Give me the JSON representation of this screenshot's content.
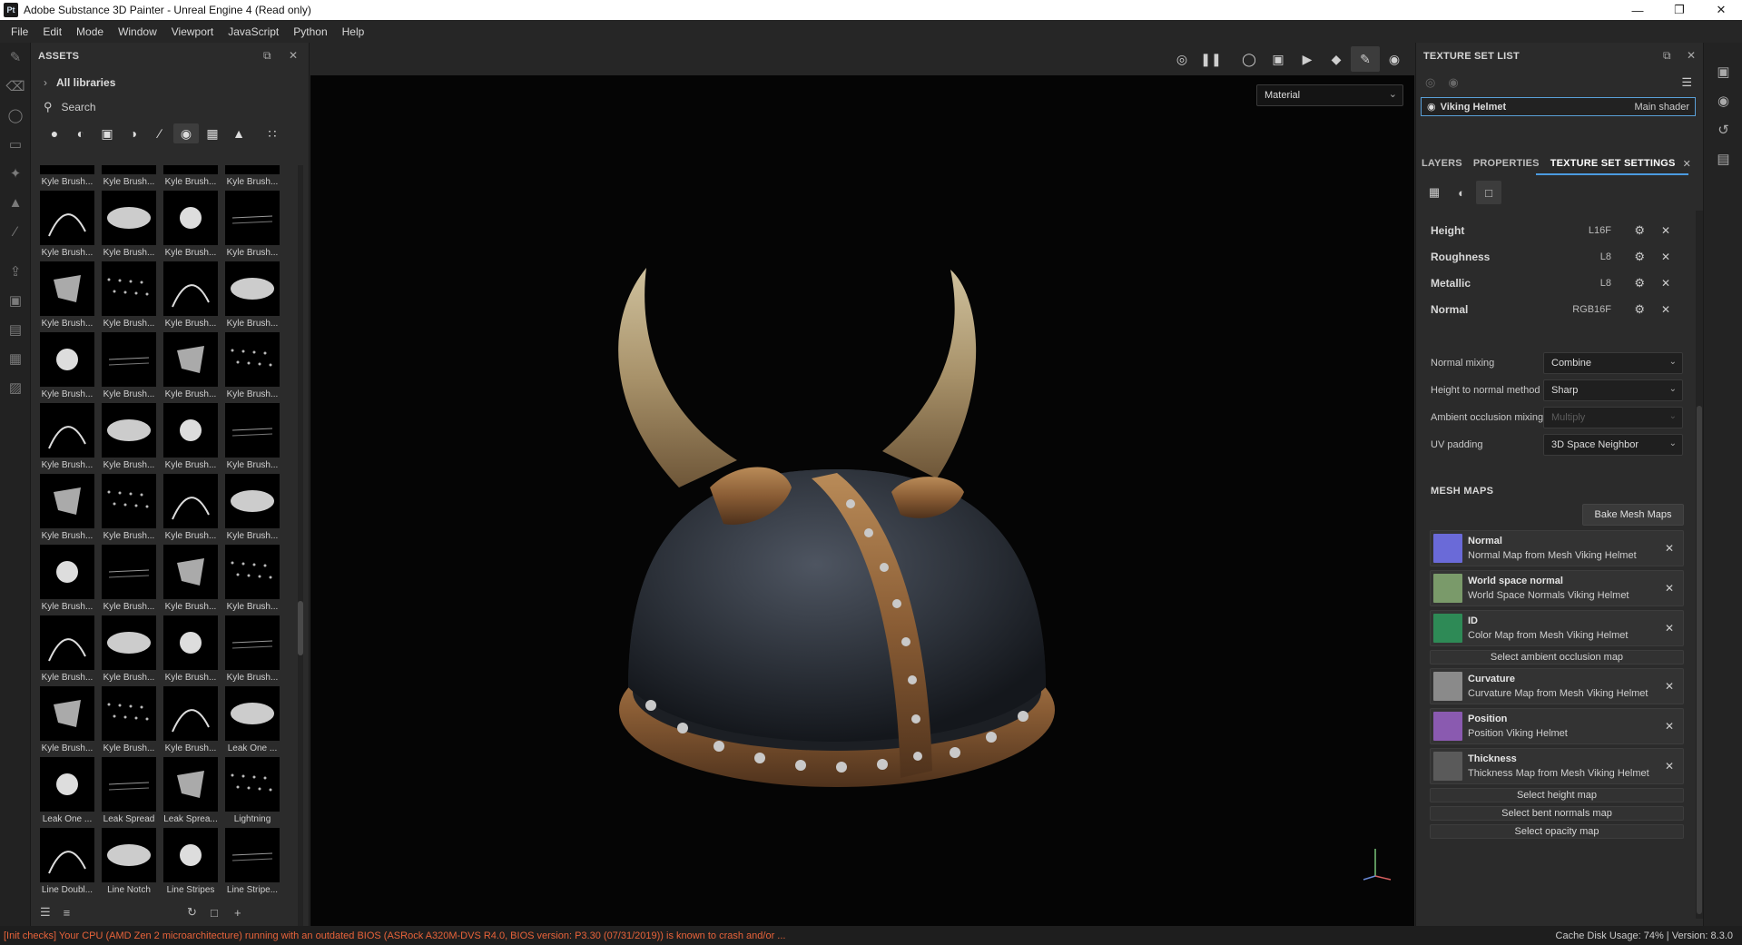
{
  "window": {
    "title": "Adobe Substance 3D Painter - Unreal Engine 4 (Read only)",
    "app_icon": "Pt"
  },
  "menu": [
    "File",
    "Edit",
    "Mode",
    "Window",
    "Viewport",
    "JavaScript",
    "Python",
    "Help"
  ],
  "assets": {
    "title": "ASSETS",
    "library": "All libraries",
    "search_placeholder": "Search",
    "items": [
      "Kyle Brush...",
      "Kyle Brush...",
      "Kyle Brush...",
      "Kyle Brush...",
      "Kyle Brush...",
      "Kyle Brush...",
      "Kyle Brush...",
      "Kyle Brush...",
      "Kyle Brush...",
      "Kyle Brush...",
      "Kyle Brush...",
      "Kyle Brush...",
      "Kyle Brush...",
      "Kyle Brush...",
      "Kyle Brush...",
      "Kyle Brush...",
      "Kyle Brush...",
      "Kyle Brush...",
      "Kyle Brush...",
      "Kyle Brush...",
      "Kyle Brush...",
      "Kyle Brush...",
      "Kyle Brush...",
      "Kyle Brush...",
      "Kyle Brush...",
      "Kyle Brush...",
      "Kyle Brush...",
      "Kyle Brush...",
      "Kyle Brush...",
      "Kyle Brush...",
      "Kyle Brush...",
      "Kyle Brush...",
      "Kyle Brush...",
      "Kyle Brush...",
      "Kyle Brush...",
      "Leak One ...",
      "Leak One ...",
      "Leak Spread",
      "Leak Sprea...",
      "Lightning",
      "Line Doubl...",
      "Line Notch",
      "Line Stripes",
      "Line Stripe..."
    ]
  },
  "viewport": {
    "material_mode": "Material"
  },
  "texture_set_list": {
    "title": "TEXTURE SET LIST",
    "set_name": "Viking Helmet",
    "shader": "Main shader"
  },
  "tabs": {
    "layers": "LAYERS",
    "properties": "PROPERTIES",
    "texture_set_settings": "TEXTURE SET SETTINGS"
  },
  "channels": [
    {
      "name": "Height",
      "format": "L16F"
    },
    {
      "name": "Roughness",
      "format": "L8"
    },
    {
      "name": "Metallic",
      "format": "L8"
    },
    {
      "name": "Normal",
      "format": "RGB16F"
    }
  ],
  "settings": [
    {
      "label": "Normal mixing",
      "value": "Combine",
      "disabled": false
    },
    {
      "label": "Height to normal method",
      "value": "Sharp",
      "disabled": false
    },
    {
      "label": "Ambient occlusion mixing",
      "value": "Multiply",
      "disabled": true
    },
    {
      "label": "UV padding",
      "value": "3D Space Neighbor",
      "disabled": false
    }
  ],
  "mesh_maps": {
    "title": "MESH MAPS",
    "bake_button": "Bake Mesh Maps",
    "maps": [
      {
        "name": "Normal",
        "source": "Normal Map from Mesh Viking Helmet",
        "color": "#6a6ad8"
      },
      {
        "name": "World space normal",
        "source": "World Space Normals Viking Helmet",
        "color": "#7a9a6a"
      },
      {
        "name": "ID",
        "source": "Color Map from Mesh Viking Helmet",
        "color": "#2e8a56"
      },
      {
        "name": "Curvature",
        "source": "Curvature Map from Mesh Viking Helmet",
        "color": "#8a8a8a"
      },
      {
        "name": "Position",
        "source": "Position Viking Helmet",
        "color": "#8a5ab0"
      },
      {
        "name": "Thickness",
        "source": "Thickness Map from Mesh Viking Helmet",
        "color": "#5a5a5a"
      }
    ],
    "select_ao": "Select ambient occlusion map",
    "select_height": "Select height map",
    "select_bent": "Select bent normals map",
    "select_opacity": "Select opacity map"
  },
  "status": {
    "error": "[Init checks] Your CPU (AMD Zen 2 microarchitecture) running with an outdated BIOS (ASRock A320M-DVS R4.0, BIOS version: P3.30 (07/31/2019)) is known to crash and/or ...",
    "info": "Cache Disk Usage:   74% | Version: 8.3.0"
  }
}
